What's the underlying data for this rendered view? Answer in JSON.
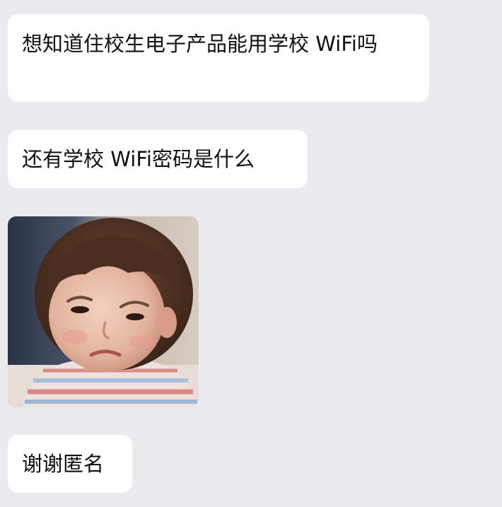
{
  "messages": [
    {
      "type": "text",
      "text": "想知道住校生电子产品能用学校 WiFi吗"
    },
    {
      "type": "text",
      "text": "还有学校 WiFi密码是什么"
    },
    {
      "type": "sticker",
      "icon": "toddler-side-eye-sticker"
    },
    {
      "type": "text",
      "text": "谢谢匿名"
    }
  ],
  "colors": {
    "background": "#ebebef",
    "bubble": "#ffffff",
    "text": "#111111"
  }
}
